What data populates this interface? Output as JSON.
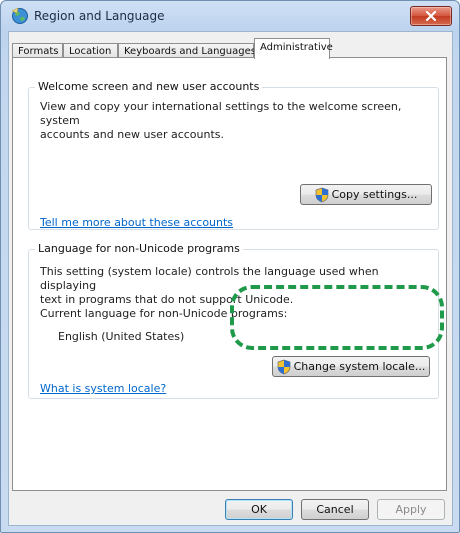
{
  "window": {
    "title": "Region and Language"
  },
  "tabs": [
    {
      "label": "Formats"
    },
    {
      "label": "Location"
    },
    {
      "label": "Keyboards and Languages"
    },
    {
      "label": "Administrative",
      "active": true
    }
  ],
  "welcome_group": {
    "title": "Welcome screen and new user accounts",
    "description_line1": "View and copy your international settings to the welcome screen, system",
    "description_line2": "accounts and new user accounts.",
    "copy_button": "Copy settings...",
    "link": "Tell me more about these accounts"
  },
  "nonunicode_group": {
    "title": "Language for non-Unicode programs",
    "description_line1": "This setting (system locale) controls the language used when displaying",
    "description_line2": "text in programs that do not support Unicode.",
    "current_label": "Current language for non-Unicode programs:",
    "current_value": "English (United States)",
    "change_button": "Change system locale...",
    "link": "What is system locale?"
  },
  "footer": {
    "ok": "OK",
    "cancel": "Cancel",
    "apply": "Apply"
  },
  "colors": {
    "highlight": "#1f9a4b",
    "link": "#0066cc",
    "close_button": "#c23b22"
  },
  "icons": [
    "globe-icon",
    "close-icon",
    "uac-shield-icon"
  ]
}
